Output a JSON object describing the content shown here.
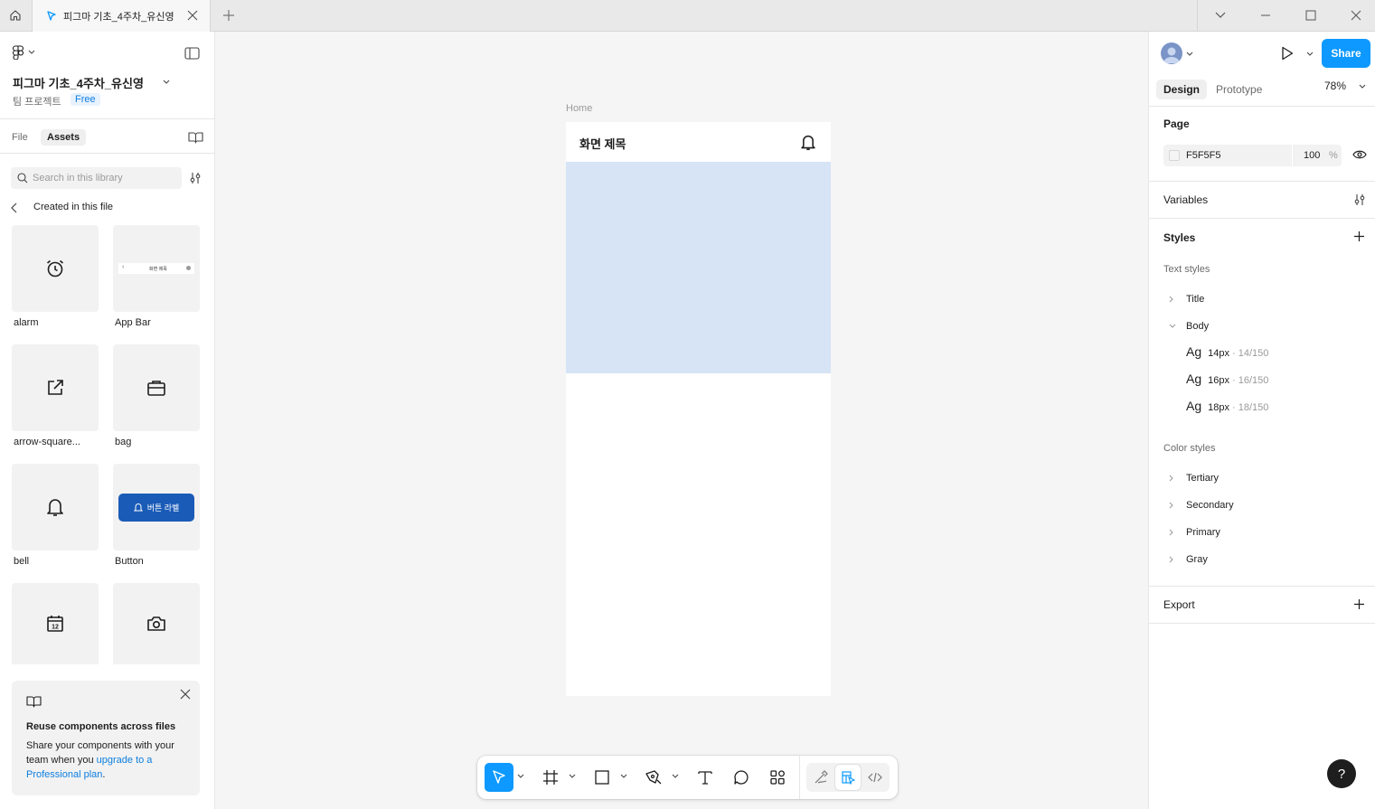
{
  "titlebar": {
    "tab_title": "피그마 기초_4주차_유신영"
  },
  "left_panel": {
    "project_title": "피그마 기초_4주차_유신영",
    "team_project": "팀 프로젝트",
    "plan_badge": "Free",
    "tabs": [
      {
        "label": "File",
        "active": false
      },
      {
        "label": "Assets",
        "active": true
      }
    ],
    "search_placeholder": "Search in this library",
    "breadcrumb": "Created in this file",
    "assets": [
      {
        "label": "alarm",
        "icon": "alarm-icon"
      },
      {
        "label": "App Bar",
        "icon": "app-bar-thumbnail"
      },
      {
        "label": "arrow-square...",
        "icon": "arrow-square-out-icon"
      },
      {
        "label": "bag",
        "icon": "bag-icon"
      },
      {
        "label": "bell",
        "icon": "bell-icon"
      },
      {
        "label": "Button",
        "icon": "button-thumbnail"
      },
      {
        "label": "",
        "icon": "calendar-icon"
      },
      {
        "label": "",
        "icon": "camera-icon"
      }
    ],
    "app_bar_thumb_text": "화면 제목",
    "button_thumb_text": "버튼 라벨",
    "promo": {
      "title": "Reuse components across files",
      "body_prefix": "Share your components with your team when you ",
      "link": "upgrade to a Professional plan",
      "body_suffix": "."
    }
  },
  "canvas": {
    "background": "#F5F5F5",
    "frame_label": "Home",
    "frame_title": "화면 제목",
    "hero_color": "#D6E4F6"
  },
  "toolbar": {
    "tools": [
      "move-tool",
      "frame-tool",
      "rectangle-tool",
      "pen-tool",
      "text-tool",
      "comment-tool",
      "actions-tool"
    ],
    "modes": [
      "draw-mode",
      "design-mode",
      "dev-mode"
    ],
    "active_tool": "move-tool",
    "active_mode": "design-mode"
  },
  "right_panel": {
    "share_label": "Share",
    "tabs": [
      {
        "label": "Design",
        "active": true
      },
      {
        "label": "Prototype",
        "active": false
      }
    ],
    "zoom": "78%",
    "page": {
      "title": "Page",
      "color_hex": "F5F5F5",
      "opacity": "100",
      "opacity_unit": "%"
    },
    "variables_label": "Variables",
    "styles": {
      "title": "Styles",
      "text_styles_heading": "Text styles",
      "text_groups": [
        {
          "name": "Title",
          "expanded": false
        },
        {
          "name": "Body",
          "expanded": true
        }
      ],
      "body_items": [
        {
          "sample": "Ag",
          "name": "14px",
          "meta": "· 14/150"
        },
        {
          "sample": "Ag",
          "name": "16px",
          "meta": "· 16/150"
        },
        {
          "sample": "Ag",
          "name": "18px",
          "meta": "· 18/150"
        }
      ],
      "color_styles_heading": "Color styles",
      "color_groups": [
        "Tertiary",
        "Secondary",
        "Primary",
        "Gray"
      ]
    },
    "export_label": "Export"
  },
  "help_label": "?",
  "colors": {
    "accent": "#0D99FF",
    "link": "#0D7FE0"
  }
}
